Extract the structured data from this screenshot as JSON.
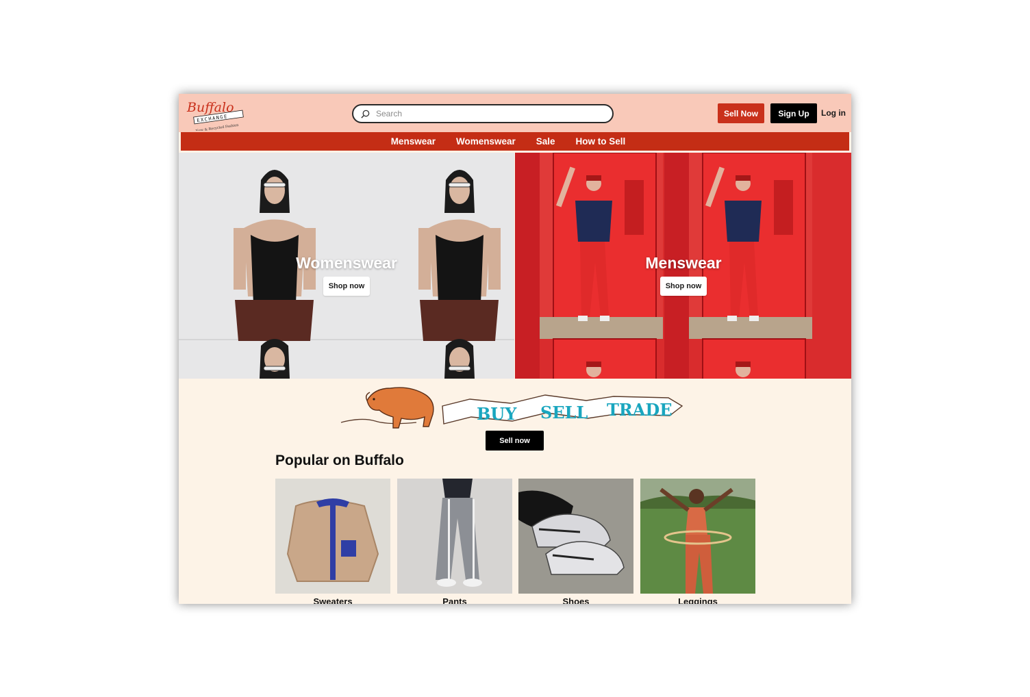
{
  "brand": {
    "logo_text": "Buffalo",
    "logo_sub": "EXCHANGE",
    "logo_tagline": "New & Recycled Fashion"
  },
  "search": {
    "placeholder": "Search"
  },
  "header": {
    "sell_label": "Sell Now",
    "signup_label": "Sign Up",
    "login_label": "Log in"
  },
  "nav": {
    "items": [
      "Menswear",
      "Womenswear",
      "Sale",
      "How to Sell"
    ]
  },
  "hero": [
    {
      "title": "Womenswear",
      "button": "Shop now"
    },
    {
      "title": "Menswear",
      "button": "Shop now"
    }
  ],
  "banner": {
    "words": [
      "BUY",
      "SELL",
      "TRADE"
    ],
    "button": "Sell now"
  },
  "popular": {
    "title": "Popular on Buffalo",
    "items": [
      {
        "label": "Sweaters"
      },
      {
        "label": "Pants"
      },
      {
        "label": "Shoes"
      },
      {
        "label": "Leggings"
      }
    ]
  },
  "colors": {
    "header_bg": "#f9c9b9",
    "nav_bg": "#c42d15",
    "page_bg": "#fdf3e7",
    "accent": "#c9301b",
    "banner_text": "#1aa6bf"
  }
}
